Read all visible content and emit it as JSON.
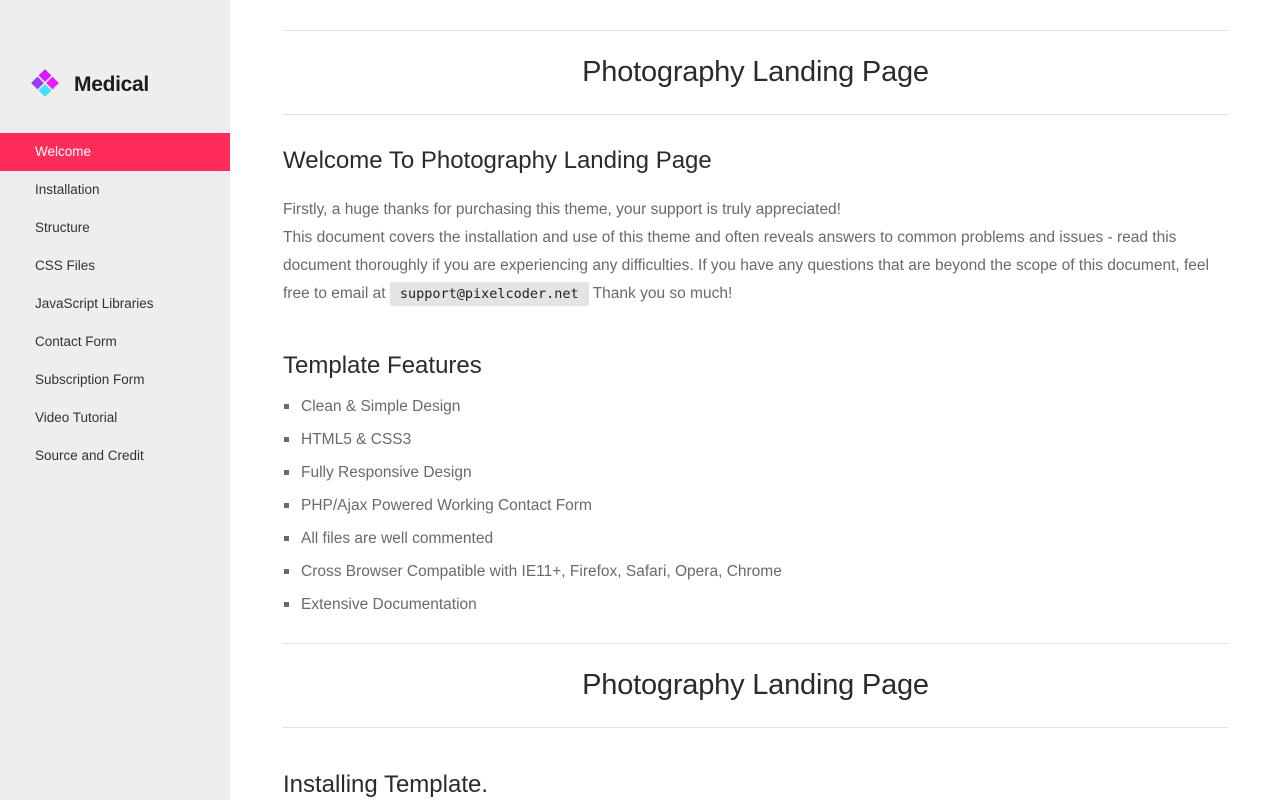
{
  "brand": {
    "name": "Medical"
  },
  "sidebar": {
    "items": [
      {
        "label": "Welcome",
        "active": true
      },
      {
        "label": "Installation",
        "active": false
      },
      {
        "label": "Structure",
        "active": false
      },
      {
        "label": "CSS Files",
        "active": false
      },
      {
        "label": "JavaScript Libraries",
        "active": false
      },
      {
        "label": "Contact Form",
        "active": false
      },
      {
        "label": "Subscription Form",
        "active": false
      },
      {
        "label": "Video Tutorial",
        "active": false
      },
      {
        "label": "Source and Credit",
        "active": false
      }
    ]
  },
  "main": {
    "header_title": "Photography Landing Page",
    "welcome_title": "Welcome To Photography Landing Page",
    "intro_line1": "Firstly, a huge thanks for purchasing this theme, your support is truly appreciated!",
    "intro_line2_pre": "This document covers the installation and use of this theme and often reveals answers to common problems and issues - read this document thoroughly if you are experiencing any difficulties. If you have any questions that are beyond the scope of this document, feel free to email at",
    "email": "support@pixelcoder.net",
    "intro_line2_post": "Thank you so much!",
    "features_title": "Template Features",
    "features": [
      "Clean & Simple Design",
      "HTML5 & CSS3",
      "Fully Responsive Design",
      "PHP/Ajax Powered Working Contact Form",
      "All files are well commented",
      "Cross Browser Compatible with IE11+, Firefox, Safari, Opera, Chrome",
      "Extensive Documentation"
    ],
    "header_title_2": "Photography Landing Page",
    "install_title": "Installing Template."
  },
  "colors": {
    "accent": "#ff2c5a",
    "sidebar_bg": "#eeeeee",
    "logo_magenta": "#e81cff",
    "logo_violet": "#9b3dff",
    "logo_cyan": "#40e0ff"
  }
}
